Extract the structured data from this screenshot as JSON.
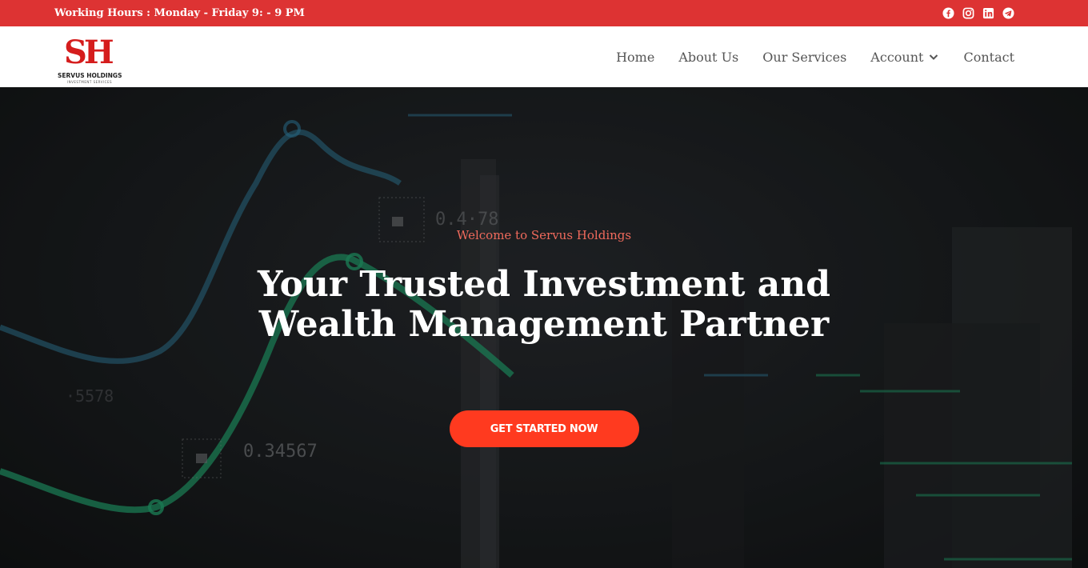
{
  "topbar": {
    "hours": "Working Hours : Monday - Friday 9: - 9 PM",
    "social": [
      {
        "name": "facebook-icon"
      },
      {
        "name": "instagram-icon"
      },
      {
        "name": "linkedin-icon"
      },
      {
        "name": "telegram-icon"
      }
    ],
    "bg_color": "#dd3333"
  },
  "logo": {
    "mark": "SH",
    "name": "SERVUS HOLDINGS",
    "subtitle": "INVESTMENT SERVICES",
    "color": "#d51d1d"
  },
  "nav": {
    "home": "Home",
    "about": "About Us",
    "services": "Our Services",
    "account": "Account",
    "contact": "Contact"
  },
  "hero": {
    "welcome": "Welcome to Servus Holdings",
    "headline": "Your Trusted Investment and Wealth Management Partner",
    "cta": "GET STARTED NOW",
    "bg_numbers": [
      "0.4·78",
      "0.34567",
      "·5578"
    ],
    "accent_color": "#ff3a1f"
  }
}
